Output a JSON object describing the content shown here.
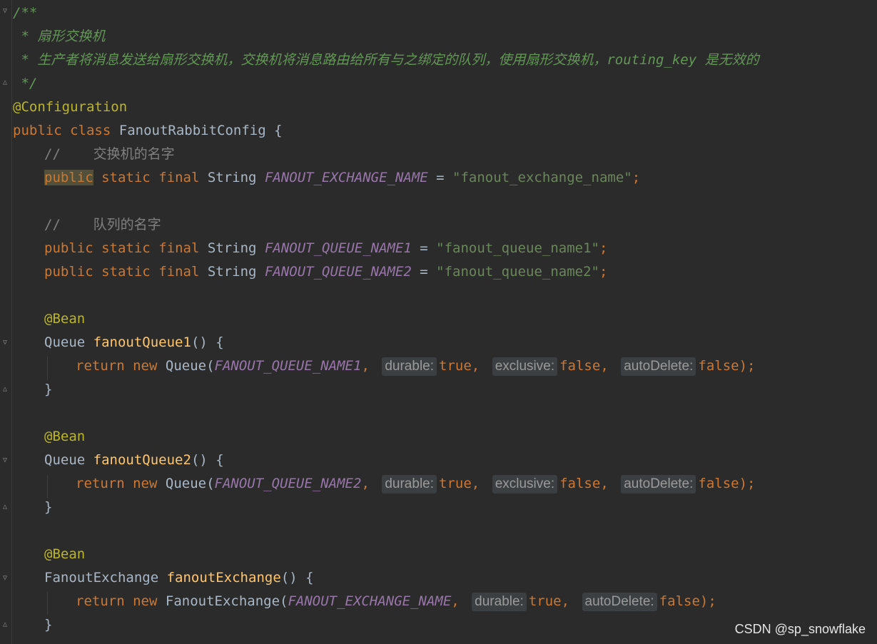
{
  "doc": {
    "open": "/**",
    "line1": " * 扇形交换机",
    "line2": " * 生产者将消息发送给扇形交换机，交换机将消息路由给所有与之绑定的队列，使用扇形交换机，routing_key 是无效的",
    "close": " */"
  },
  "annotation_config": "@Configuration",
  "class_decl": {
    "kw1": "public",
    "kw2": "class",
    "name": "FanoutRabbitConfig",
    "brace": "{"
  },
  "comment_exchange": "//    交换机的名字",
  "comment_queue": "//    队列的名字",
  "modifiers": {
    "public": "public",
    "static": "static",
    "final": "final",
    "type": "String"
  },
  "fields": [
    {
      "name": "FANOUT_EXCHANGE_NAME",
      "value": "\"fanout_exchange_name\""
    },
    {
      "name": "FANOUT_QUEUE_NAME1",
      "value": "\"fanout_queue_name1\""
    },
    {
      "name": "FANOUT_QUEUE_NAME2",
      "value": "\"fanout_queue_name2\""
    }
  ],
  "bean": "@Bean",
  "methods": [
    {
      "ret_type": "Queue",
      "name": "fanoutQueue1",
      "arg": "FANOUT_QUEUE_NAME1"
    },
    {
      "ret_type": "Queue",
      "name": "fanoutQueue2",
      "arg": "FANOUT_QUEUE_NAME2"
    },
    {
      "ret_type": "FanoutExchange",
      "name": "fanoutExchange",
      "arg": "FANOUT_EXCHANGE_NAME"
    }
  ],
  "kw_return": "return",
  "kw_new": "new",
  "hints": {
    "durable": "durable:",
    "exclusive": "exclusive:",
    "autoDelete": "autoDelete:"
  },
  "vals": {
    "true": "true",
    "false": "false"
  },
  "punct": {
    "eq": " = ",
    "semi": ";",
    "parens": "() ",
    "lbrace": "{",
    "rbrace": "}",
    "lparen": "(",
    "comma": ",",
    "close_call": ");"
  },
  "watermark": "CSDN @sp_snowflake"
}
